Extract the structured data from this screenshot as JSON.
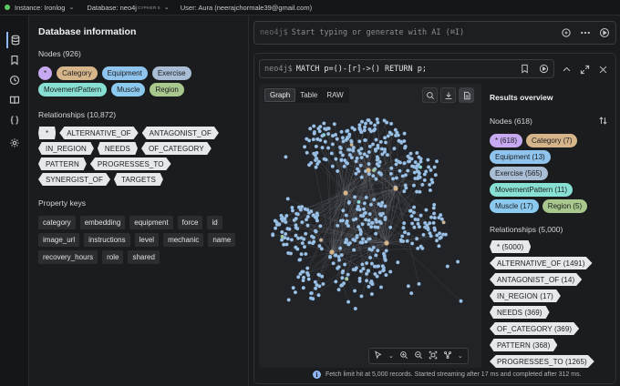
{
  "topbar": {
    "instance_label": "Instance: Ironlog",
    "database_label": "Database: neo4j",
    "database_tag": "CYPHER 5",
    "user_label": "User: Aura (neerajchormale39@gmail.com)"
  },
  "rail": {
    "icons": [
      "database-icon",
      "bookmark-icon",
      "history-icon",
      "book-icon",
      "code-braces-icon",
      "gear-icon"
    ],
    "active": "database-icon"
  },
  "db_info": {
    "title": "Database information",
    "nodes_heading": "Nodes (926)",
    "node_labels": [
      {
        "label": "*",
        "color": "#c7a9f2"
      },
      {
        "label": "Category",
        "color": "#d7b58a"
      },
      {
        "label": "Equipment",
        "color": "#8fc4ee"
      },
      {
        "label": "Exercise",
        "color": "#a9bdd4"
      },
      {
        "label": "MovementPattern",
        "color": "#88dfd3"
      },
      {
        "label": "Muscle",
        "color": "#8cc9ef"
      },
      {
        "label": "Region",
        "color": "#a8c88e"
      }
    ],
    "relationships_heading": "Relationships (10,872)",
    "relationship_types": [
      "*",
      "ALTERNATIVE_OF",
      "ANTAGONIST_OF",
      "IN_REGION",
      "NEEDS",
      "OF_CATEGORY",
      "PATTERN",
      "PROGRESSES_TO",
      "SYNERGIST_OF",
      "TARGETS"
    ],
    "property_keys_heading": "Property keys",
    "property_keys": [
      "category",
      "embedding",
      "equipment",
      "force",
      "id",
      "image_url",
      "instructions",
      "level",
      "mechanic",
      "name",
      "recovery_hours",
      "role",
      "shared"
    ]
  },
  "editor": {
    "prompt": "neo4j$",
    "placeholder": "Start typing or generate with AI (⌘I)"
  },
  "result": {
    "prompt": "neo4j$",
    "query": "MATCH p=()-[r]->() RETURN p;",
    "view_tabs": [
      "Graph",
      "Table",
      "RAW"
    ],
    "active_view": "Graph",
    "overview": {
      "title": "Results overview",
      "nodes_heading": "Nodes (618)",
      "node_labels": [
        {
          "label": "* (618)",
          "color": "#c7a9f2"
        },
        {
          "label": "Category (7)",
          "color": "#d7b58a"
        },
        {
          "label": "Equipment (13)",
          "color": "#8fc4ee"
        },
        {
          "label": "Exercise (565)",
          "color": "#a9bdd4"
        },
        {
          "label": "MovementPattern (11)",
          "color": "#88dfd3"
        },
        {
          "label": "Muscle (17)",
          "color": "#8cc9ef"
        },
        {
          "label": "Region (5)",
          "color": "#a8c88e"
        }
      ],
      "relationships_heading": "Relationships (5,000)",
      "relationship_types": [
        "* (5000)",
        "ALTERNATIVE_OF (1491)",
        "ANTAGONIST_OF (14)",
        "IN_REGION (17)",
        "NEEDS (369)",
        "OF_CATEGORY (369)",
        "PATTERN (368)",
        "PROGRESSES_TO (1265)"
      ]
    },
    "status_text": "Fetch limit hit at 5,000 records. Started streaming after 17 ms and completed after 312 ms."
  },
  "graph_colors": {
    "node": "#9fc3e6",
    "node_stroke": "#6f9ac2",
    "edge": "#6c6f75",
    "accent_nodes": [
      "#d7b58a",
      "#88dfd3",
      "#8fc4ee",
      "#a8c88e"
    ]
  }
}
